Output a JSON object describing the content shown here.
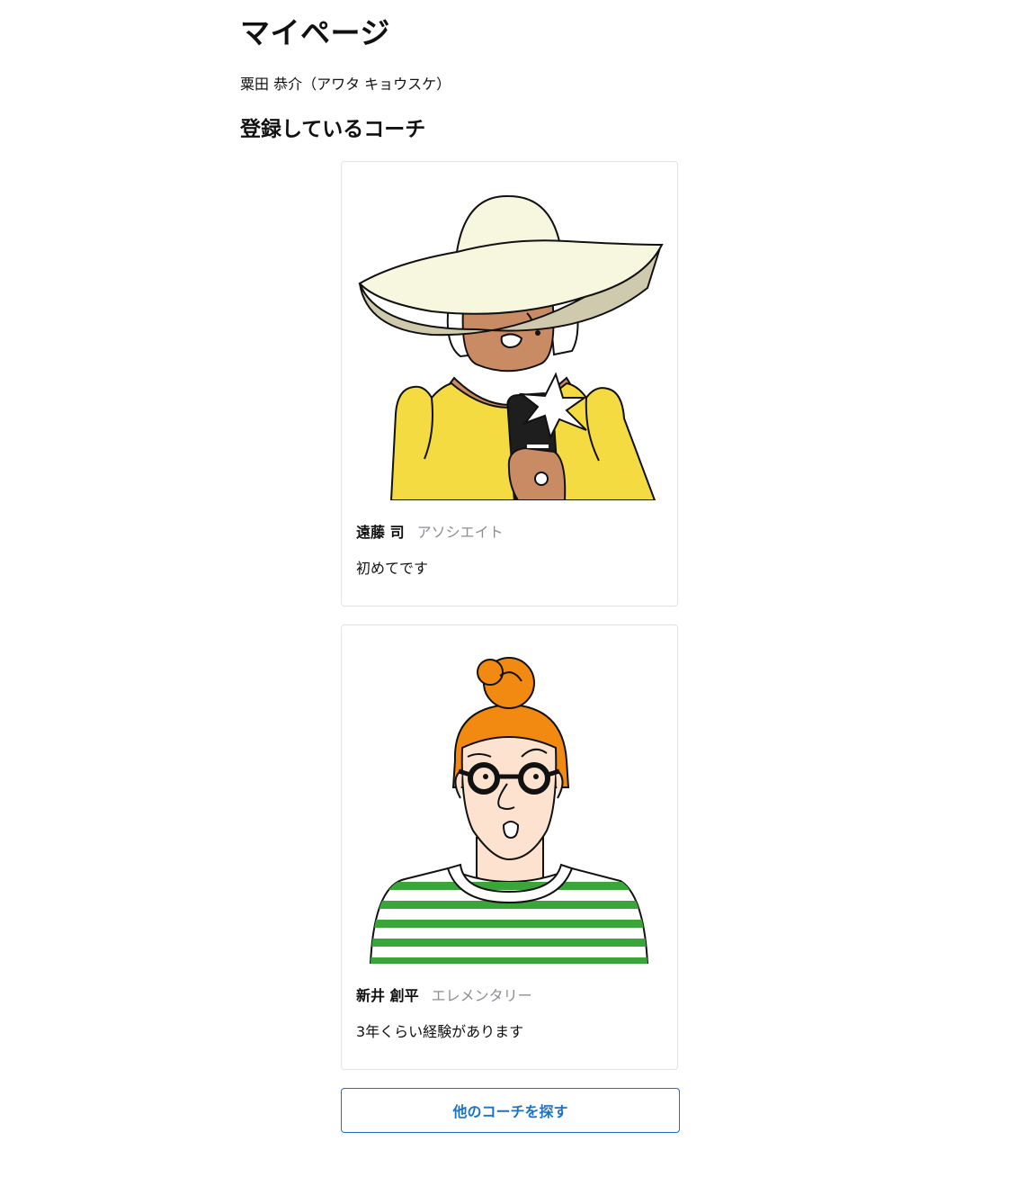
{
  "page": {
    "title": "マイページ",
    "user_name": "粟田 恭介（アワタ キョウスケ）",
    "section_title": "登録しているコーチ"
  },
  "coaches": [
    {
      "name": "遠藤 司",
      "level": "アソシエイト",
      "message": "初めてです",
      "illustration": "woman-with-sun-hat-and-phone"
    },
    {
      "name": "新井 創平",
      "level": "エレメンタリー",
      "message": "3年くらい経験があります",
      "illustration": "person-with-orange-bun-and-glasses"
    }
  ],
  "actions": {
    "find_other_coaches": "他のコーチを探す"
  },
  "colors": {
    "accent": "#1a73c8",
    "level_text": "#8a8f95",
    "card_border": "#e3e3e3"
  }
}
